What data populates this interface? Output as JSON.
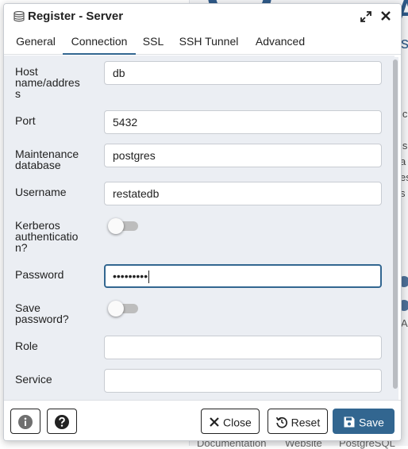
{
  "dialog": {
    "title": "Register - Server"
  },
  "tabs": [
    {
      "label": "General"
    },
    {
      "label": "Connection"
    },
    {
      "label": "SSL"
    },
    {
      "label": "SSH Tunnel"
    },
    {
      "label": "Advanced"
    }
  ],
  "active_tab": "Connection",
  "form": {
    "host": {
      "label_lines": [
        "Host",
        "name/addres",
        "s"
      ],
      "value": "db"
    },
    "port": {
      "label": "Port",
      "value": "5432"
    },
    "maintenance_db": {
      "label_lines": [
        "Maintenance",
        "database"
      ],
      "value": "postgres"
    },
    "username": {
      "label": "Username",
      "value": "restatedb"
    },
    "kerberos": {
      "label_lines": [
        "Kerberos",
        "authenticatio",
        "n?"
      ],
      "enabled": false
    },
    "password": {
      "label": "Password",
      "value": "•••••••••"
    },
    "save_password": {
      "label_lines": [
        "Save",
        "password?"
      ],
      "enabled": false
    },
    "role": {
      "label": "Role",
      "value": ""
    },
    "service": {
      "label": "Service",
      "value": ""
    }
  },
  "footer": {
    "close_label": "Close",
    "reset_label": "Reset",
    "save_label": "Save"
  },
  "background": {
    "logo_fragment": "A",
    "side_text_fragments": [
      "s",
      "ic",
      "is",
      "a",
      "es",
      "s",
      "A"
    ],
    "footer_links": [
      "Documentation",
      "Website",
      "PostgreSQL"
    ]
  },
  "colors": {
    "accent": "#326690",
    "form_background": "#ebeef3",
    "border": "#c8ccd2"
  },
  "icons": {
    "title": "server-stack-icon",
    "expand": "expand-icon",
    "close": "close-icon",
    "info": "info-icon",
    "help": "help-icon",
    "reset": "reset-icon",
    "save": "floppy-disk-icon"
  }
}
